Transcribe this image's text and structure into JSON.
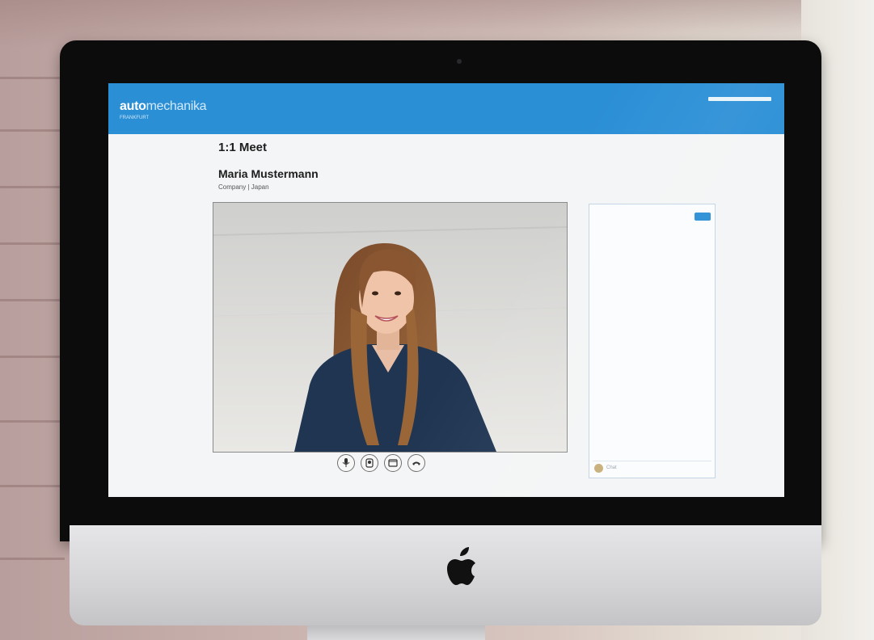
{
  "app": {
    "brand_bold": "auto",
    "brand_light": "mechanika",
    "brand_sub": "FRANKFURT"
  },
  "meeting": {
    "title": "1:1 Meet",
    "participant_name": "Maria Mustermann",
    "participant_info": "Company | Japan"
  },
  "controls": [
    {
      "icon": "microphone-icon"
    },
    {
      "icon": "camera-icon"
    },
    {
      "icon": "screen-share-icon"
    },
    {
      "icon": "hang-up-icon"
    }
  ],
  "chat": {
    "placeholder": "Chat"
  },
  "colors": {
    "accent": "#2b8fd6",
    "bezel": "#0c0c0d",
    "screen_bg": "#f4f5f6"
  }
}
